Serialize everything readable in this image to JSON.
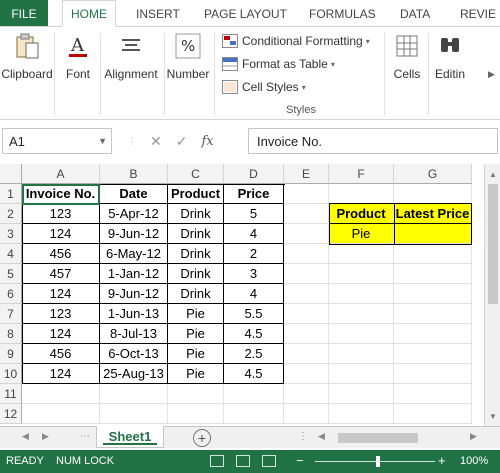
{
  "ribbon": {
    "tabs": [
      "FILE",
      "HOME",
      "INSERT",
      "PAGE LAYOUT",
      "FORMULAS",
      "DATA",
      "REVIE"
    ],
    "active_tab": "HOME",
    "clipboard_label": "Clipboard",
    "font_label": "Font",
    "alignment_label": "Alignment",
    "number_label": "Number",
    "conditional_formatting": "Conditional Formatting",
    "format_as_table": "Format as Table",
    "cell_styles": "Cell Styles",
    "styles_group": "Styles",
    "cells_label": "Cells",
    "editing_label": "Editin"
  },
  "formula_bar": {
    "name_box": "A1",
    "content": "Invoice No."
  },
  "columns": [
    "A",
    "B",
    "C",
    "D",
    "E",
    "F",
    "G"
  ],
  "rows": [
    "1",
    "2",
    "3",
    "4",
    "5",
    "6",
    "7",
    "8",
    "9",
    "10",
    "11",
    "12"
  ],
  "table": {
    "headers": [
      "Invoice No.",
      "Date",
      "Product",
      "Price"
    ],
    "rows": [
      [
        "123",
        "5-Apr-12",
        "Drink",
        "5"
      ],
      [
        "124",
        "9-Jun-12",
        "Drink",
        "4"
      ],
      [
        "456",
        "6-May-12",
        "Drink",
        "2"
      ],
      [
        "457",
        "1-Jan-12",
        "Drink",
        "3"
      ],
      [
        "124",
        "9-Jun-12",
        "Drink",
        "4"
      ],
      [
        "123",
        "1-Jun-13",
        "Pie",
        "5.5"
      ],
      [
        "124",
        "8-Jul-13",
        "Pie",
        "4.5"
      ],
      [
        "456",
        "6-Oct-13",
        "Pie",
        "2.5"
      ],
      [
        "124",
        "25-Aug-13",
        "Pie",
        "4.5"
      ]
    ]
  },
  "lookup": {
    "header_product": "Product",
    "header_latest_price": "Latest Price",
    "product_value": "Pie",
    "latest_price_value": ""
  },
  "sheet_tab": "Sheet1",
  "status": {
    "ready": "READY",
    "num_lock": "NUM LOCK",
    "zoom": "100%"
  },
  "colors": {
    "excel_green": "#217346",
    "highlight_yellow": "#ffff00"
  }
}
